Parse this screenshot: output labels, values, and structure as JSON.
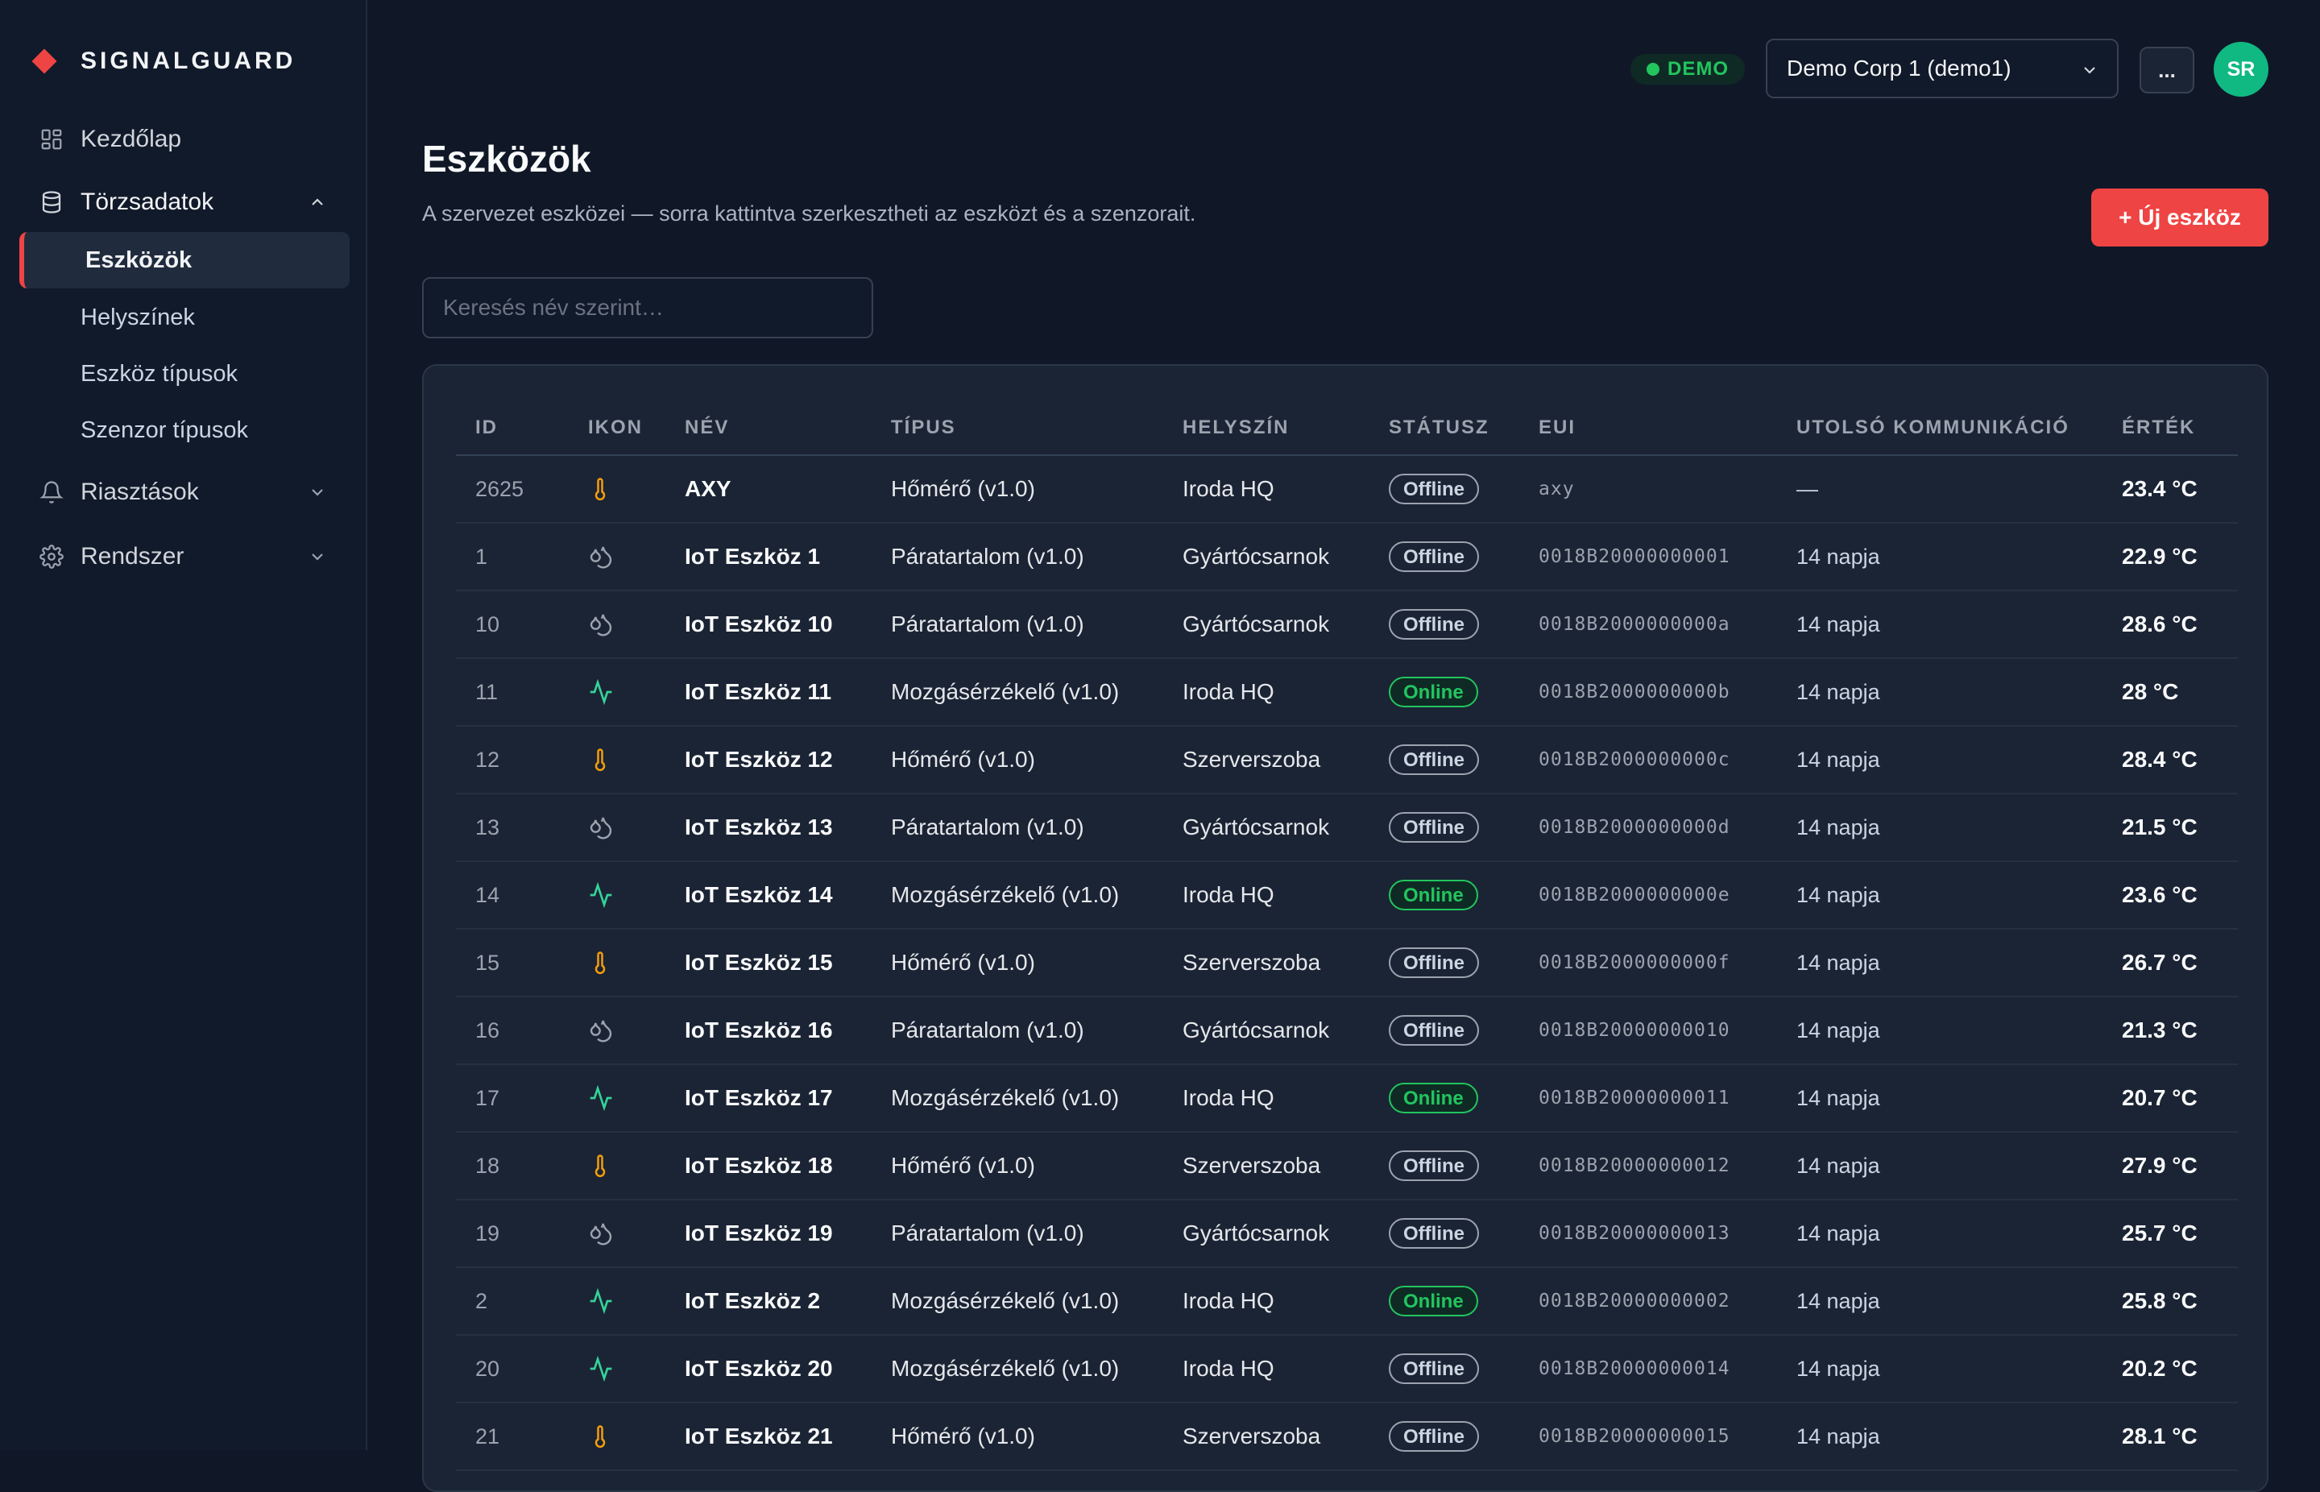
{
  "brand": {
    "name": "SIGNALGUARD"
  },
  "sidebar": {
    "items": [
      {
        "label": "Kezdőlap",
        "icon": "dashboard-icon"
      },
      {
        "label": "Törzsadatok",
        "icon": "database-icon",
        "expanded": true,
        "children": [
          "Eszközök",
          "Helyszínek",
          "Eszköz típusok",
          "Szenzor típusok"
        ],
        "active_child": "Eszközök"
      },
      {
        "label": "Riasztások",
        "icon": "bell-icon",
        "expanded": false
      },
      {
        "label": "Rendszer",
        "icon": "gear-icon",
        "expanded": false
      }
    ]
  },
  "header": {
    "demo_badge": "DEMO",
    "org_select": "Demo Corp 1 (demo1)",
    "more_label": "...",
    "avatar_initials": "SR"
  },
  "page": {
    "title": "Eszközök",
    "subtitle": "A szervezet eszközei — sorra kattintva szerkesztheti az eszközt és a szenzorait.",
    "new_button": "+ Új eszköz",
    "search_placeholder": "Keresés név szerint…"
  },
  "table": {
    "columns": [
      "ID",
      "IKON",
      "NÉV",
      "TÍPUS",
      "HELYSZÍN",
      "STÁTUSZ",
      "EUI",
      "UTOLSÓ KOMMUNIKÁCIÓ",
      "ÉRTÉK"
    ],
    "rows": [
      {
        "id": "2625",
        "icon": "thermometer-icon",
        "name": "AXY",
        "type": "Hőmérő (v1.0)",
        "location": "Iroda HQ",
        "status": "Offline",
        "eui": "axy",
        "last": "—",
        "value": "23.4 °C"
      },
      {
        "id": "1",
        "icon": "droplets-icon",
        "name": "IoT Eszköz 1",
        "type": "Páratartalom (v1.0)",
        "location": "Gyártócsarnok",
        "status": "Offline",
        "eui": "0018B20000000001",
        "last": "14 napja",
        "value": "22.9 °C"
      },
      {
        "id": "10",
        "icon": "droplets-icon",
        "name": "IoT Eszköz 10",
        "type": "Páratartalom (v1.0)",
        "location": "Gyártócsarnok",
        "status": "Offline",
        "eui": "0018B2000000000a",
        "last": "14 napja",
        "value": "28.6 °C"
      },
      {
        "id": "11",
        "icon": "activity-icon",
        "name": "IoT Eszköz 11",
        "type": "Mozgásérzékelő (v1.0)",
        "location": "Iroda HQ",
        "status": "Online",
        "eui": "0018B2000000000b",
        "last": "14 napja",
        "value": "28 °C"
      },
      {
        "id": "12",
        "icon": "thermometer-icon",
        "name": "IoT Eszköz 12",
        "type": "Hőmérő (v1.0)",
        "location": "Szerverszoba",
        "status": "Offline",
        "eui": "0018B2000000000c",
        "last": "14 napja",
        "value": "28.4 °C"
      },
      {
        "id": "13",
        "icon": "droplets-icon",
        "name": "IoT Eszköz 13",
        "type": "Páratartalom (v1.0)",
        "location": "Gyártócsarnok",
        "status": "Offline",
        "eui": "0018B2000000000d",
        "last": "14 napja",
        "value": "21.5 °C"
      },
      {
        "id": "14",
        "icon": "activity-icon",
        "name": "IoT Eszköz 14",
        "type": "Mozgásérzékelő (v1.0)",
        "location": "Iroda HQ",
        "status": "Online",
        "eui": "0018B2000000000e",
        "last": "14 napja",
        "value": "23.6 °C"
      },
      {
        "id": "15",
        "icon": "thermometer-icon",
        "name": "IoT Eszköz 15",
        "type": "Hőmérő (v1.0)",
        "location": "Szerverszoba",
        "status": "Offline",
        "eui": "0018B2000000000f",
        "last": "14 napja",
        "value": "26.7 °C"
      },
      {
        "id": "16",
        "icon": "droplets-icon",
        "name": "IoT Eszköz 16",
        "type": "Páratartalom (v1.0)",
        "location": "Gyártócsarnok",
        "status": "Offline",
        "eui": "0018B20000000010",
        "last": "14 napja",
        "value": "21.3 °C"
      },
      {
        "id": "17",
        "icon": "activity-icon",
        "name": "IoT Eszköz 17",
        "type": "Mozgásérzékelő (v1.0)",
        "location": "Iroda HQ",
        "status": "Online",
        "eui": "0018B20000000011",
        "last": "14 napja",
        "value": "20.7 °C"
      },
      {
        "id": "18",
        "icon": "thermometer-icon",
        "name": "IoT Eszköz 18",
        "type": "Hőmérő (v1.0)",
        "location": "Szerverszoba",
        "status": "Offline",
        "eui": "0018B20000000012",
        "last": "14 napja",
        "value": "27.9 °C"
      },
      {
        "id": "19",
        "icon": "droplets-icon",
        "name": "IoT Eszköz 19",
        "type": "Páratartalom (v1.0)",
        "location": "Gyártócsarnok",
        "status": "Offline",
        "eui": "0018B20000000013",
        "last": "14 napja",
        "value": "25.7 °C"
      },
      {
        "id": "2",
        "icon": "activity-icon",
        "name": "IoT Eszköz 2",
        "type": "Mozgásérzékelő (v1.0)",
        "location": "Iroda HQ",
        "status": "Online",
        "eui": "0018B20000000002",
        "last": "14 napja",
        "value": "25.8 °C"
      },
      {
        "id": "20",
        "icon": "activity-icon",
        "name": "IoT Eszköz 20",
        "type": "Mozgásérzékelő (v1.0)",
        "location": "Iroda HQ",
        "status": "Offline",
        "eui": "0018B20000000014",
        "last": "14 napja",
        "value": "20.2 °C"
      },
      {
        "id": "21",
        "icon": "thermometer-icon",
        "name": "IoT Eszköz 21",
        "type": "Hőmérő (v1.0)",
        "location": "Szerverszoba",
        "status": "Offline",
        "eui": "0018B20000000015",
        "last": "14 napja",
        "value": "28.1 °C"
      }
    ]
  },
  "colors": {
    "background": "#101827",
    "sidebar": "#111a2a",
    "card": "#1b2434",
    "accent": "#ef4444",
    "online": "#22c55e",
    "thermometer": "#f59e0b",
    "activity": "#34d399",
    "droplets": "#9ca3af"
  }
}
